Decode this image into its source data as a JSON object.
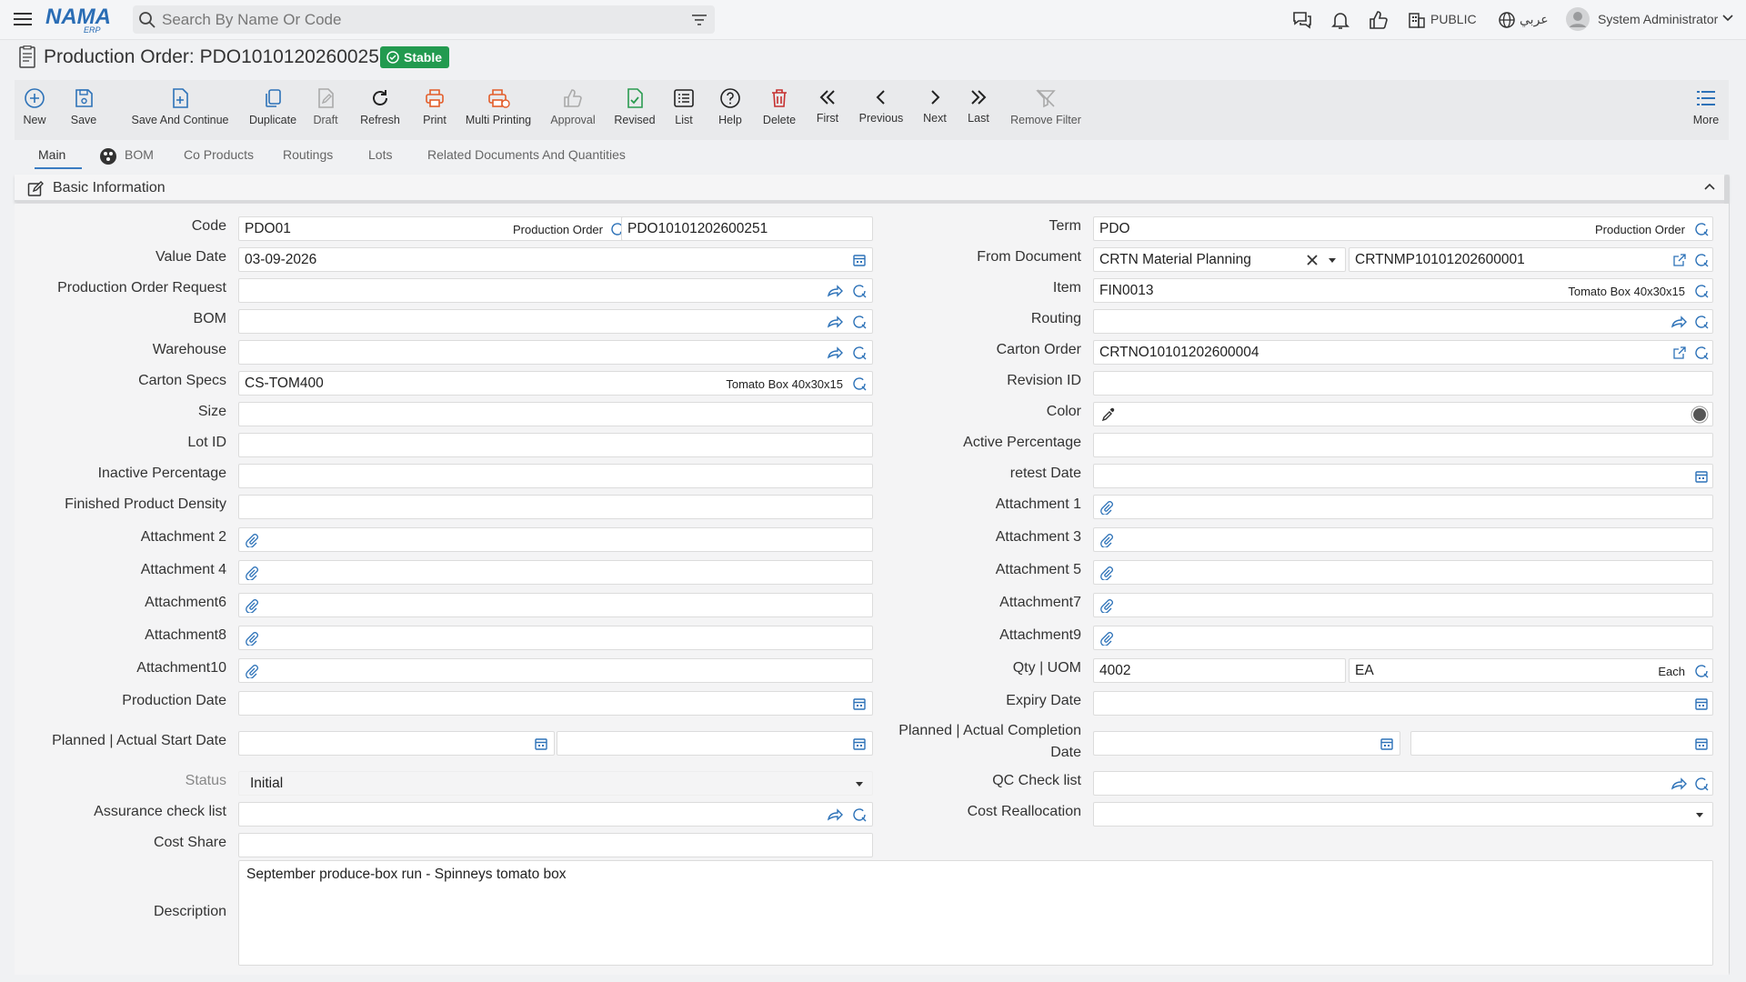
{
  "topbar": {
    "search_placeholder": "Search By Name Or Code",
    "branch": "PUBLIC",
    "language": "عربي",
    "user": "System Administrator",
    "logo_text": "NAMA",
    "logo_sub": "ERP"
  },
  "page": {
    "title": "Production Order: PDO10101202600251",
    "status_badge": "Stable"
  },
  "toolbar": {
    "new": "New",
    "save": "Save",
    "save_continue": "Save And Continue",
    "duplicate": "Duplicate",
    "draft": "Draft",
    "refresh": "Refresh",
    "print": "Print",
    "multi_printing": "Multi Printing",
    "approval": "Approval",
    "revised": "Revised",
    "list": "List",
    "help": "Help",
    "delete": "Delete",
    "first": "First",
    "previous": "Previous",
    "next": "Next",
    "last": "Last",
    "remove_filter": "Remove Filter",
    "more": "More"
  },
  "tabs": {
    "main": "Main",
    "bom": "BOM",
    "co_products": "Co Products",
    "routings": "Routings",
    "lots": "Lots",
    "related": "Related Documents And Quantities"
  },
  "section": {
    "title": "Basic Information"
  },
  "labels": {
    "code": "Code",
    "value_date": "Value Date",
    "production_order_request": "Production Order Request",
    "bom": "BOM",
    "warehouse": "Warehouse",
    "carton_specs": "Carton Specs",
    "size": "Size",
    "lot_id": "Lot ID",
    "inactive_percentage": "Inactive Percentage",
    "finished_product_density": "Finished Product Density",
    "attachment2": "Attachment 2",
    "attachment4": "Attachment 4",
    "attachment6": "Attachment6",
    "attachment8": "Attachment8",
    "attachment10": "Attachment10",
    "production_date": "Production Date",
    "planned_actual_start": "Planned | Actual Start Date",
    "status": "Status",
    "assurance_check_list": "Assurance check list",
    "cost_share": "Cost Share",
    "description": "Description",
    "term": "Term",
    "from_document": "From Document",
    "item": "Item",
    "routing": "Routing",
    "carton_order": "Carton Order",
    "revision_id": "Revision ID",
    "color": "Color",
    "active_percentage": "Active Percentage",
    "retest_date": "retest Date",
    "attachment1": "Attachment 1",
    "attachment3": "Attachment 3",
    "attachment5": "Attachment 5",
    "attachment7": "Attachment7",
    "attachment9": "Attachment9",
    "qty_uom": "Qty | UOM",
    "expiry_date": "Expiry Date",
    "planned_actual_completion": "Planned | Actual Completion Date",
    "qc_check_list": "QC Check list",
    "cost_reallocation": "Cost Reallocation"
  },
  "values": {
    "code": "PDO01",
    "code_desc": "Production Order",
    "code_number": "PDO10101202600251",
    "value_date": "03-09-2026",
    "carton_specs": "CS-TOM400",
    "carton_specs_desc": "Tomato Box 40x30x15",
    "status": "Initial",
    "description": "September produce-box run - Spinneys tomato box",
    "term": "PDO",
    "term_desc": "Production Order",
    "from_document": "CRTN Material Planning",
    "from_document_number": "CRTNMP10101202600001",
    "item": "FIN0013",
    "item_desc": "Tomato Box 40x30x15",
    "carton_order": "CRTNO10101202600004",
    "qty": "4002",
    "uom": "EA",
    "uom_desc": "Each"
  }
}
